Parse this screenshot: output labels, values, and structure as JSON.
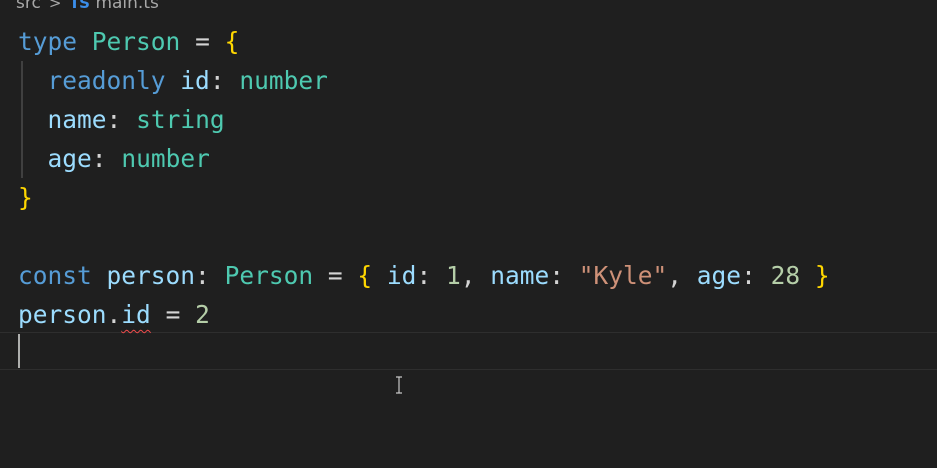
{
  "breadcrumb": {
    "folder": "src",
    "separator": ">",
    "file_icon": "typescript-file-icon",
    "file_icon_text": "TS",
    "file": "main.ts"
  },
  "code": {
    "line1": {
      "kw": "type",
      "name": "Person",
      "eq": "=",
      "brace": "{"
    },
    "line2": {
      "mod": "readonly",
      "prop": "id",
      "colon": ":",
      "type": "number"
    },
    "line3": {
      "prop": "name",
      "colon": ":",
      "type": "string"
    },
    "line4": {
      "prop": "age",
      "colon": ":",
      "type": "number"
    },
    "line5": {
      "brace": "}"
    },
    "line7": {
      "kw": "const",
      "var": "person",
      "colon": ":",
      "type": "Person",
      "eq": "=",
      "open": "{",
      "p1": "id",
      "v1": "1",
      "p2": "name",
      "v2": "\"Kyle\"",
      "p3": "age",
      "v3": "28",
      "close": "}"
    },
    "line8": {
      "obj": "person",
      "dot": ".",
      "prop": "id",
      "eq": "=",
      "val": "2"
    }
  },
  "colors": {
    "background": "#1f1f1f",
    "keyword": "#569cd6",
    "type": "#4ec9b0",
    "brace": "#ffd700",
    "property": "#9cdcfe",
    "number": "#b5cea8",
    "string": "#ce9178",
    "error": "#f14c4c"
  }
}
